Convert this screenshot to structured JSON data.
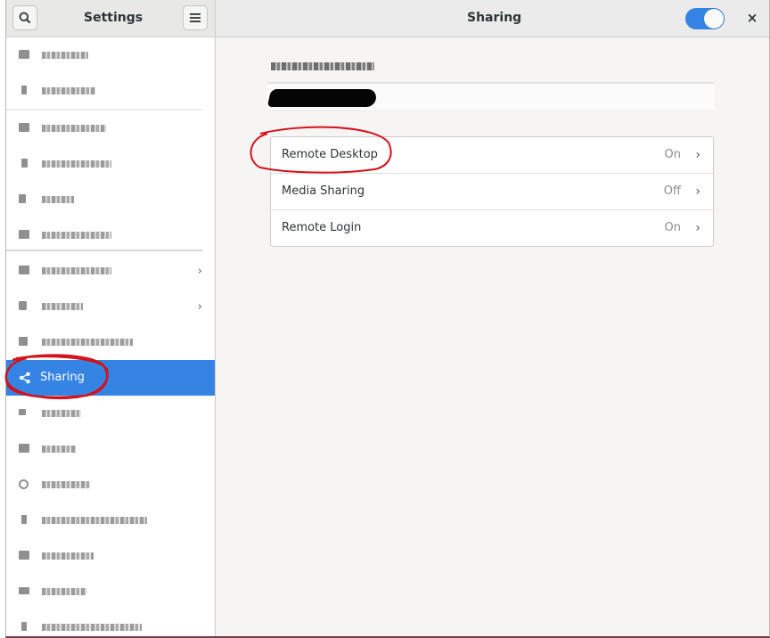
{
  "header": {
    "sidebar_title": "Settings",
    "page_title": "Sharing",
    "sharing_switch": "on"
  },
  "sidebar": {
    "active_item": {
      "label": "Sharing",
      "icon": "share-icon"
    },
    "items_obscured": true
  },
  "content": {
    "computer_name_value_redacted": true,
    "rows": [
      {
        "label": "Remote Desktop",
        "status": "On"
      },
      {
        "label": "Media Sharing",
        "status": "Off"
      },
      {
        "label": "Remote Login",
        "status": "On"
      }
    ]
  },
  "colors": {
    "accent": "#3584e4",
    "annotation": "#d4121b"
  }
}
